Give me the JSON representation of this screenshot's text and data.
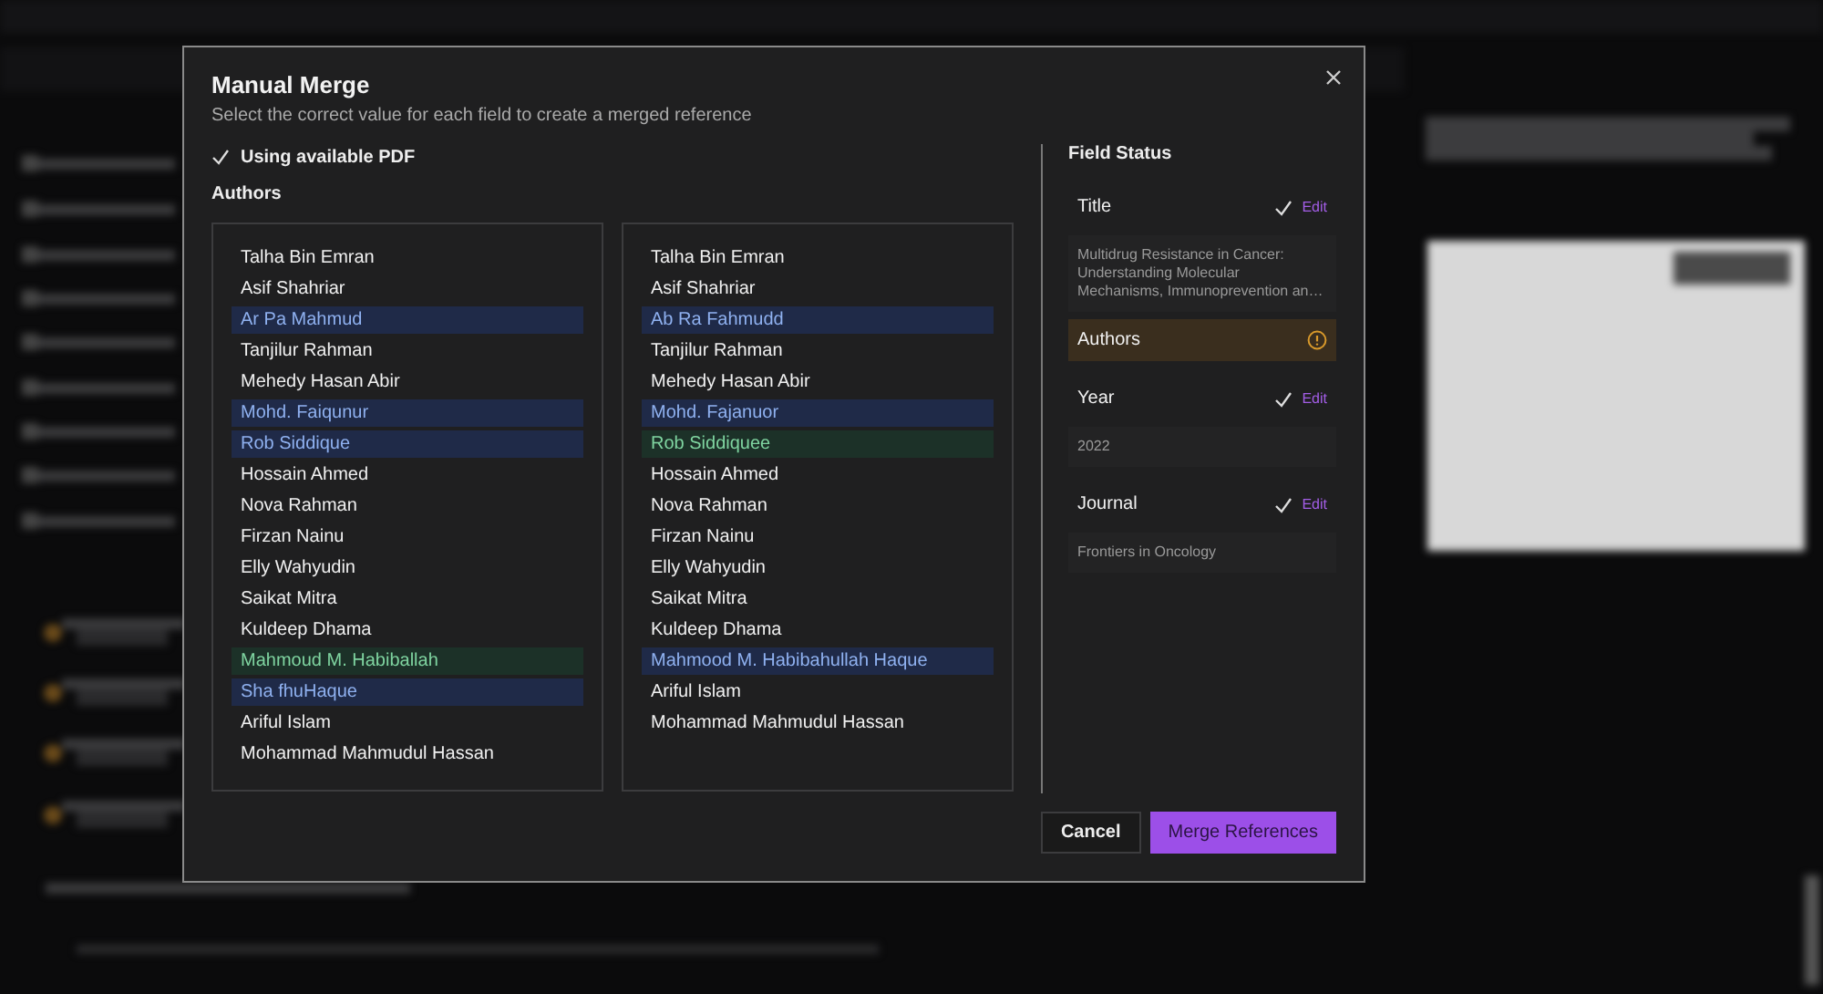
{
  "dialog": {
    "title": "Manual Merge",
    "subtitle": "Select the correct value for each field to create a merged reference",
    "pdf_option": {
      "label": "Using available PDF",
      "checked": true
    },
    "authors_label": "Authors",
    "author_columns": [
      [
        {
          "name": "Talha Bin Emran",
          "kind": "plain"
        },
        {
          "name": "Asif Shahriar",
          "kind": "plain"
        },
        {
          "name": "Ar Pa Mahmud",
          "kind": "differs"
        },
        {
          "name": "Tanjilur Rahman",
          "kind": "plain"
        },
        {
          "name": "Mehedy Hasan Abir",
          "kind": "plain"
        },
        {
          "name": "Mohd. Faiqunur",
          "kind": "differs"
        },
        {
          "name": "Rob Siddique",
          "kind": "differs"
        },
        {
          "name": "Hossain Ahmed",
          "kind": "plain"
        },
        {
          "name": "Nova Rahman",
          "kind": "plain"
        },
        {
          "name": "Firzan Nainu",
          "kind": "plain"
        },
        {
          "name": "Elly Wahyudin",
          "kind": "plain"
        },
        {
          "name": "Saikat Mitra",
          "kind": "plain"
        },
        {
          "name": "Kuldeep Dhama",
          "kind": "plain"
        },
        {
          "name": "Mahmoud M. Habiballah",
          "kind": "chosen"
        },
        {
          "name": "Sha fhuHaque",
          "kind": "differs"
        },
        {
          "name": "Ariful Islam",
          "kind": "plain"
        },
        {
          "name": "Mohammad Mahmudul Hassan",
          "kind": "plain"
        }
      ],
      [
        {
          "name": "Talha Bin Emran",
          "kind": "plain"
        },
        {
          "name": "Asif Shahriar",
          "kind": "plain"
        },
        {
          "name": "Ab Ra Fahmudd",
          "kind": "differs"
        },
        {
          "name": "Tanjilur Rahman",
          "kind": "plain"
        },
        {
          "name": "Mehedy Hasan Abir",
          "kind": "plain"
        },
        {
          "name": "Mohd. Fajanuor",
          "kind": "differs"
        },
        {
          "name": "Rob Siddiquee",
          "kind": "chosen"
        },
        {
          "name": "Hossain Ahmed",
          "kind": "plain"
        },
        {
          "name": "Nova Rahman",
          "kind": "plain"
        },
        {
          "name": "Firzan Nainu",
          "kind": "plain"
        },
        {
          "name": "Elly Wahyudin",
          "kind": "plain"
        },
        {
          "name": "Saikat Mitra",
          "kind": "plain"
        },
        {
          "name": "Kuldeep Dhama",
          "kind": "plain"
        },
        {
          "name": "Mahmood M. Habibahullah Haque",
          "kind": "differs"
        },
        {
          "name": "Ariful Islam",
          "kind": "plain"
        },
        {
          "name": "Mohammad Mahmudul Hassan",
          "kind": "plain"
        }
      ]
    ],
    "field_status": {
      "heading": "Field Status",
      "fields": [
        {
          "name": "Title",
          "resolved": true,
          "action": "Edit",
          "value": "Multidrug Resistance in Cancer: Understanding Molecular Mechanisms, Immunoprevention an…"
        },
        {
          "name": "Authors",
          "resolved": false
        },
        {
          "name": "Year",
          "resolved": true,
          "action": "Edit",
          "value": "2022"
        },
        {
          "name": "Journal",
          "resolved": true,
          "action": "Edit",
          "value": "Frontiers in Oncology"
        }
      ]
    },
    "buttons": {
      "cancel": "Cancel",
      "confirm": "Merge References"
    }
  }
}
